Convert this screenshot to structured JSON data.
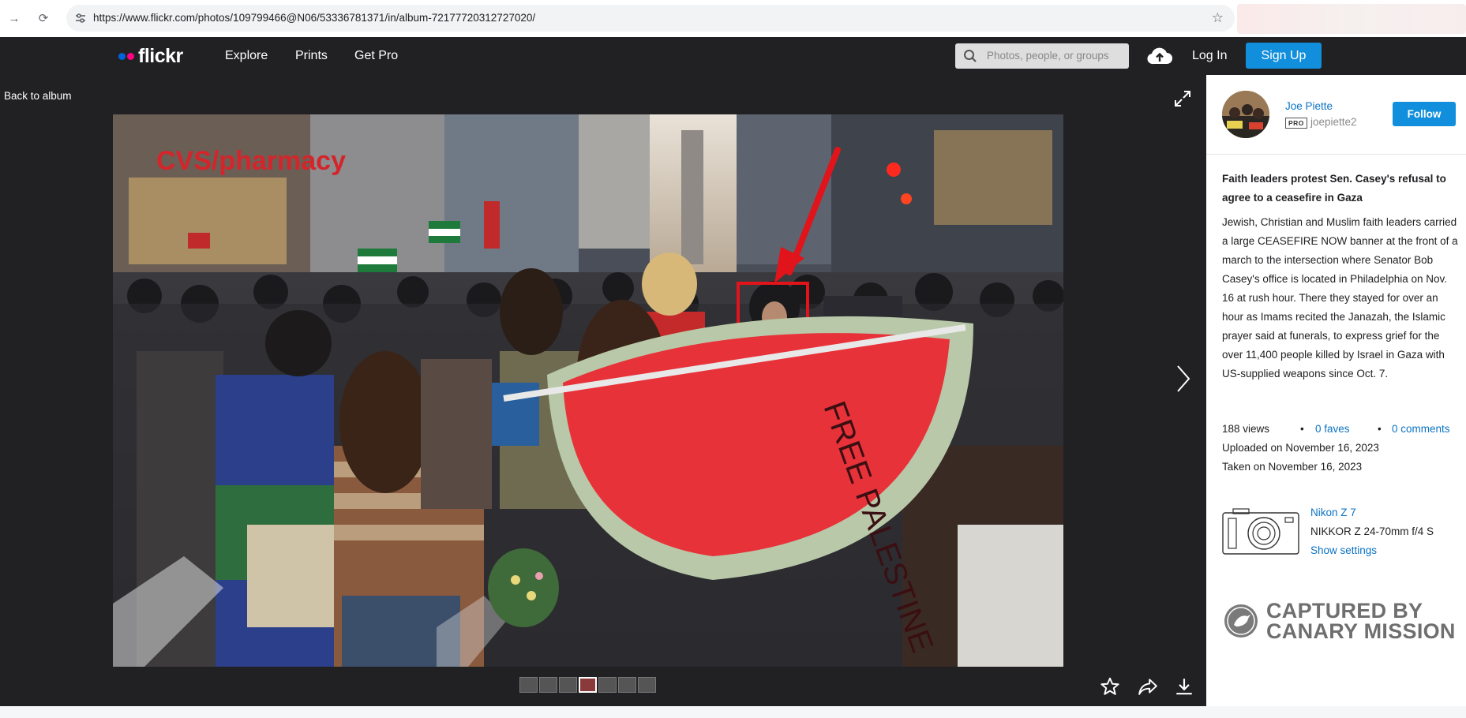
{
  "browser": {
    "url": "https://www.flickr.com/photos/109799466@N06/53336781371/in/album-72177720312727020/"
  },
  "header": {
    "logo": "flickr",
    "nav": [
      "Explore",
      "Prints",
      "Get Pro"
    ],
    "search_placeholder": "Photos, people, or groups",
    "login": "Log In",
    "signup": "Sign Up"
  },
  "photo_area": {
    "back_label": "Back to album",
    "thumbnail_count": 7,
    "active_thumbnail": 4
  },
  "sidebar": {
    "owner_name": "Joe Piette",
    "pro_badge": "PRO",
    "owner_username": "joepiette2",
    "follow_label": "Follow",
    "title": "Faith leaders protest Sen. Casey's refusal to agree to a ceasefire in Gaza",
    "description": "Jewish, Christian and Muslim faith leaders carried a large CEASEFIRE NOW banner at the front of a march to the intersection where Senator Bob Casey's office is located in Philadelphia on Nov. 16 at rush hour. There they stayed for over an hour as Imams recited the Janazah, the Islamic prayer said at funerals, to express grief for the over 11,400 people killed by Israel in Gaza with US-supplied weapons since Oct. 7.",
    "views": "188 views",
    "faves": "0 faves",
    "comments": "0 comments",
    "uploaded": "Uploaded on November 16, 2023",
    "taken": "Taken on November 16, 2023",
    "camera_model": "Nikon Z 7",
    "lens": "NIKKOR Z 24-70mm f/4 S",
    "show_settings": "Show settings",
    "watermark_line1": "CAPTURED BY",
    "watermark_line2": "CANARY MISSION"
  },
  "photo_scene": {
    "storefront_sign": "CVS/pharmacy",
    "banner_text": "FREE PALESTINE"
  },
  "colors": {
    "flickr_blue": "#0063dc",
    "flickr_pink": "#ff0084",
    "button_blue": "#128fdc",
    "link_blue": "#0b73c4",
    "dark_bg": "#212124",
    "highlight_red": "#e0141a"
  }
}
